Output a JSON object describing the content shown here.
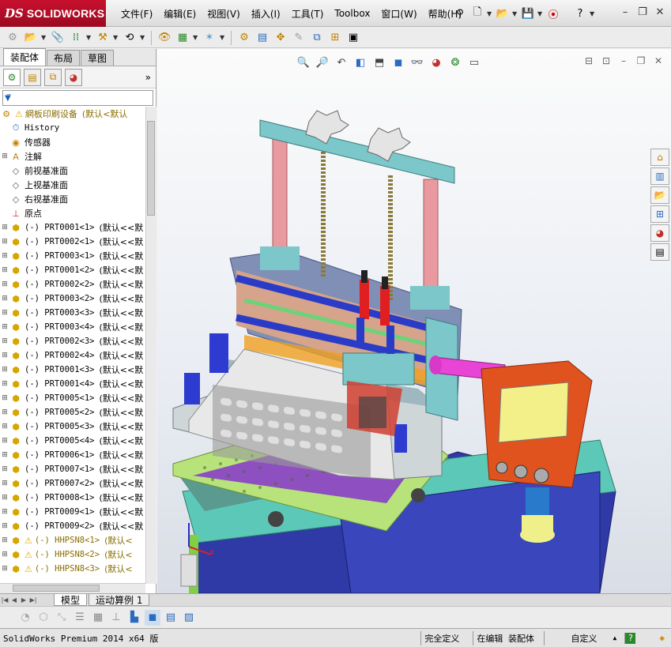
{
  "app": {
    "brand_prefix": "DS",
    "brand_name": "SOLIDWORKS"
  },
  "menu": [
    "文件(F)",
    "编辑(E)",
    "视图(V)",
    "插入(I)",
    "工具(T)",
    "Toolbox",
    "窗口(W)",
    "帮助(H)"
  ],
  "panel_tabs": [
    "装配体",
    "布局",
    "草图"
  ],
  "tree": {
    "root": {
      "name": "網板印刷设备",
      "config": "(默认<默认"
    },
    "items": [
      {
        "name": "History",
        "icon": "history-icon",
        "mono": true
      },
      {
        "name": "传感器",
        "icon": "sensor-icon"
      },
      {
        "name": "注解",
        "icon": "annotation-icon",
        "expand": true
      },
      {
        "name": "前视基准面",
        "icon": "plane-icon"
      },
      {
        "name": "上视基准面",
        "icon": "plane-icon"
      },
      {
        "name": "右视基准面",
        "icon": "plane-icon"
      },
      {
        "name": "原点",
        "icon": "origin-icon"
      }
    ],
    "parts": [
      {
        "name": "(-) PRT0001<1>",
        "config": "(默认<<默"
      },
      {
        "name": "(-) PRT0002<1>",
        "config": "(默认<<默"
      },
      {
        "name": "(-) PRT0003<1>",
        "config": "(默认<<默"
      },
      {
        "name": "(-) PRT0001<2>",
        "config": "(默认<<默"
      },
      {
        "name": "(-) PRT0002<2>",
        "config": "(默认<<默"
      },
      {
        "name": "(-) PRT0003<2>",
        "config": "(默认<<默"
      },
      {
        "name": "(-) PRT0003<3>",
        "config": "(默认<<默"
      },
      {
        "name": "(-) PRT0003<4>",
        "config": "(默认<<默"
      },
      {
        "name": "(-) PRT0002<3>",
        "config": "(默认<<默"
      },
      {
        "name": "(-) PRT0002<4>",
        "config": "(默认<<默"
      },
      {
        "name": "(-) PRT0001<3>",
        "config": "(默认<<默"
      },
      {
        "name": "(-) PRT0001<4>",
        "config": "(默认<<默"
      },
      {
        "name": "(-) PRT0005<1>",
        "config": "(默认<<默"
      },
      {
        "name": "(-) PRT0005<2>",
        "config": "(默认<<默"
      },
      {
        "name": "(-) PRT0005<3>",
        "config": "(默认<<默"
      },
      {
        "name": "(-) PRT0005<4>",
        "config": "(默认<<默"
      },
      {
        "name": "(-) PRT0006<1>",
        "config": "(默认<<默"
      },
      {
        "name": "(-) PRT0007<1>",
        "config": "(默认<<默"
      },
      {
        "name": "(-) PRT0007<2>",
        "config": "(默认<<默"
      },
      {
        "name": "(-) PRT0008<1>",
        "config": "(默认<<默"
      },
      {
        "name": "(-) PRT0009<1>",
        "config": "(默认<<默"
      },
      {
        "name": "(-) PRT0009<2>",
        "config": "(默认<<默"
      }
    ],
    "warn_parts": [
      {
        "name": "(-) HHPSN8<1>",
        "config": "(默认<"
      },
      {
        "name": "(-) HHPSN8<2>",
        "config": "(默认<"
      },
      {
        "name": "(-) HHPSN8<3>",
        "config": "(默认<"
      }
    ]
  },
  "bottom_tabs": [
    "模型",
    "运动算例 1"
  ],
  "status": {
    "version": "SolidWorks Premium 2014 x64 版",
    "constraint": "完全定义",
    "mode": "在编辑 装配体",
    "units": "自定义"
  },
  "colors": {
    "brand": "#c8102e",
    "frame": "#7cc7c9",
    "base_plate": "#b7e37a",
    "cabinet": "#2f3aa6",
    "control_box": "#e0531f",
    "carriage": "#e02020"
  }
}
